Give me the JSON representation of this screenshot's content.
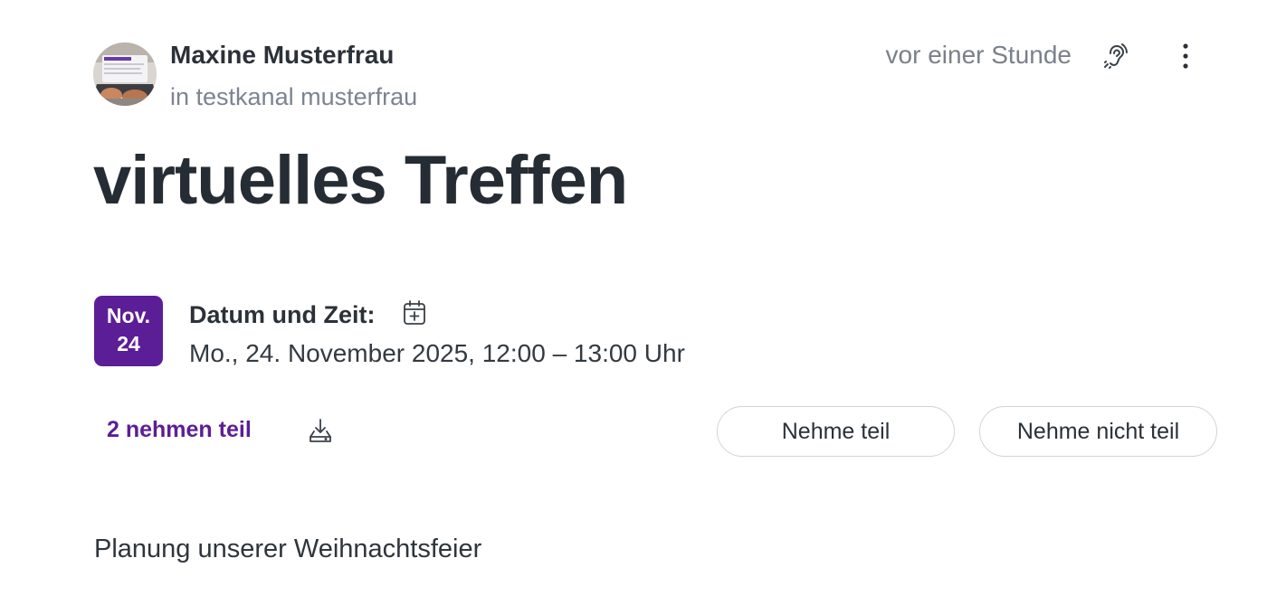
{
  "post": {
    "author_name": "Maxine Musterfrau",
    "channel_line": "in testkanal musterfrau",
    "timestamp": "vor einer Stunde",
    "icons": {
      "listen": "ear-icon",
      "more": "more-vertical-icon"
    }
  },
  "event": {
    "title": "virtuelles Treffen",
    "badge_month": "Nov.",
    "badge_day": "24",
    "datetime_label": "Datum und Zeit:",
    "datetime_value": "Mo., 24. November 2025, 12:00 – 13:00 Uhr",
    "add_calendar_icon": "calendar-plus-icon",
    "participants_text": "2 nehmen teil",
    "download_icon": "download-icon",
    "attend_button": "Nehme teil",
    "decline_button": "Nehme nicht teil",
    "description": "Planung unserer Weihnachtsfeier"
  },
  "colors": {
    "accent": "#5c1e96",
    "text_primary": "#2b3138",
    "text_muted": "#7b8490",
    "border": "#d0d4d9"
  }
}
